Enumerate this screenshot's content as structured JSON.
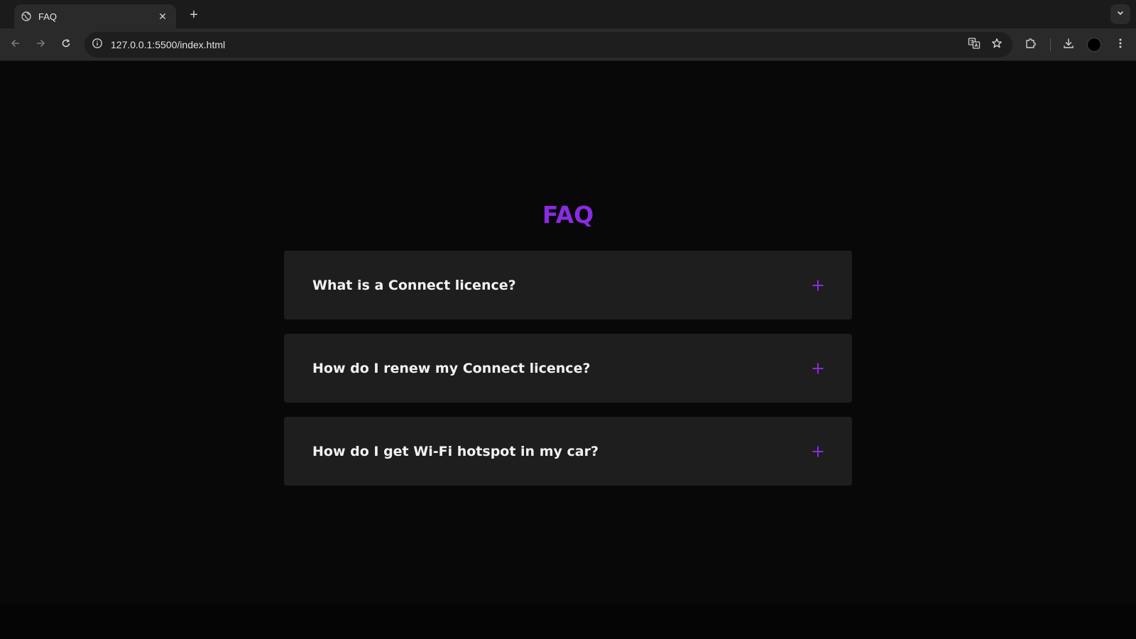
{
  "browser": {
    "tab": {
      "title": "FAQ"
    },
    "new_tab_label": "+",
    "tab_close_label": "✕",
    "url": "127.0.0.1:5500/index.html"
  },
  "page": {
    "title": "FAQ",
    "faq_items": [
      {
        "question": "What is a Connect licence?",
        "icon": "plus-icon"
      },
      {
        "question": "How do I renew my Connect licence?",
        "icon": "plus-icon"
      },
      {
        "question": "How do I get Wi-Fi hotspot in my car?",
        "icon": "plus-icon"
      }
    ]
  },
  "colors": {
    "accent": "#8a2be2",
    "page_background": "#080808",
    "card_background": "#1e1e1e",
    "question_text": "#f2f2f2"
  }
}
